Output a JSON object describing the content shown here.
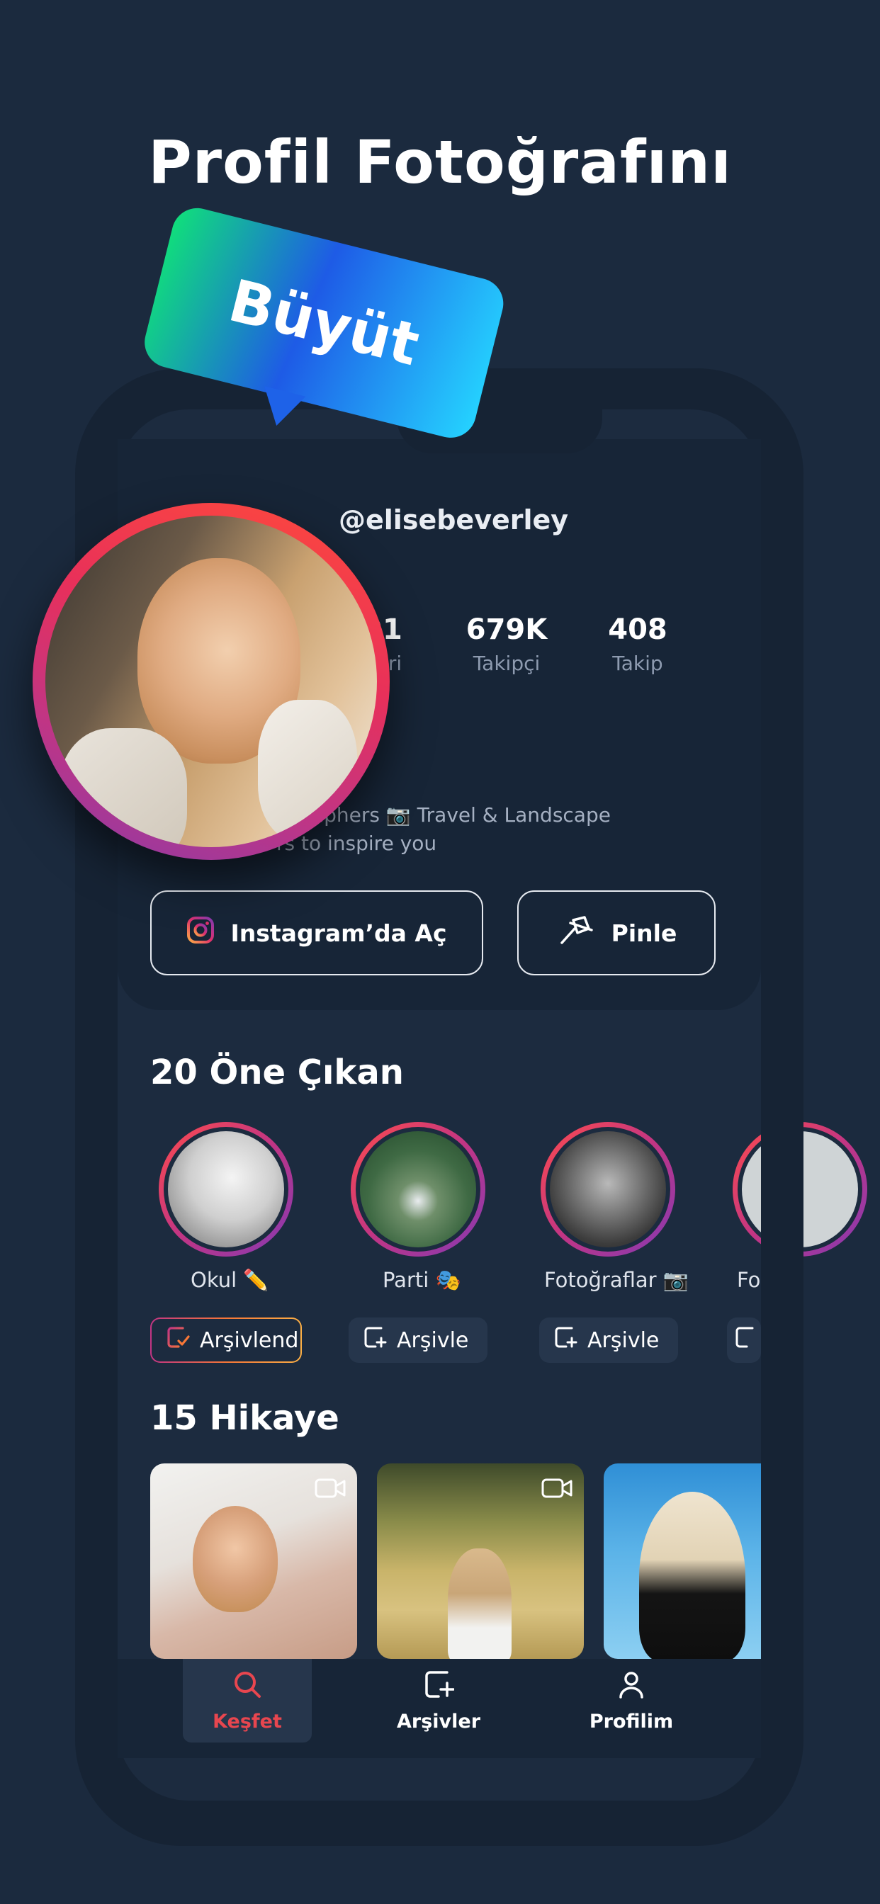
{
  "headline": "Profil Fotoğrafını",
  "badge": {
    "text": "Büyüt"
  },
  "profile": {
    "username": "@elisebeverley",
    "stats": [
      {
        "num": "91",
        "label": "deri"
      },
      {
        "num": "679K",
        "label": "Takipçi"
      },
      {
        "num": "408",
        "label": "Takip"
      }
    ],
    "bio_line1": "aphers 📷  Travel & Landscape",
    "bio_line2": "rs to inspire you"
  },
  "actions": {
    "instagram_label": "Instagram’da Aç",
    "pin_label": "Pinle"
  },
  "highlights": {
    "title": "20 Öne Çıkan",
    "items": [
      {
        "label": "Okul ✏️",
        "button": "Arşivlendi",
        "archived": true
      },
      {
        "label": "Parti 🎭",
        "button": "Arşivle",
        "archived": false
      },
      {
        "label": "Fotoğraflar 📷",
        "button": "Arşivle",
        "archived": false
      },
      {
        "label": "Fo",
        "button": "",
        "archived": false
      }
    ]
  },
  "stories": {
    "title": "15 Hikaye"
  },
  "tabs": [
    {
      "label": "Keşfet",
      "icon": "search-icon",
      "active": true
    },
    {
      "label": "Arşivler",
      "icon": "add-archive-icon",
      "active": false
    },
    {
      "label": "Profilim",
      "icon": "user-icon",
      "active": false
    }
  ],
  "colors": {
    "background": "#1b2a3e",
    "accent": "#e8464f",
    "badge_gradient": [
      "#10e07a",
      "#1e5be6",
      "#25d4ff"
    ]
  }
}
